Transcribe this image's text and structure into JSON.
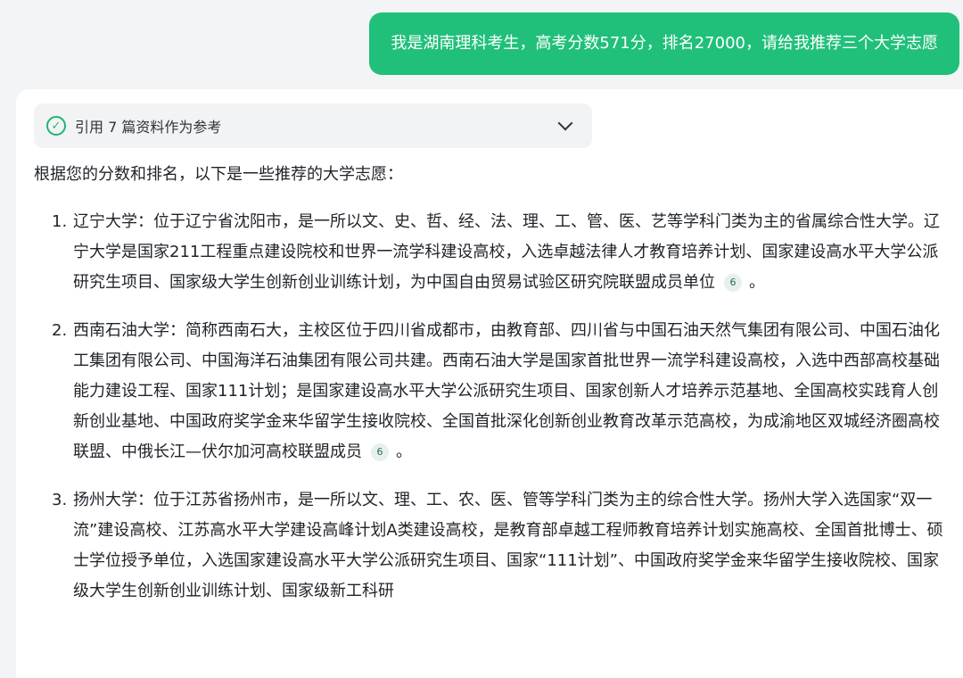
{
  "user_message": "我是湖南理科考生，高考分数571分，排名27000，请给我推荐三个大学志愿",
  "references": {
    "label": "引用 7 篇资料作为参考"
  },
  "answer": {
    "intro": "根据您的分数和排名，以下是一些推荐的大学志愿：",
    "items": [
      {
        "number": "1.",
        "text": "辽宁大学：位于辽宁省沈阳市，是一所以文、史、哲、经、法、理、工、管、医、艺等学科门类为主的省属综合性大学。辽宁大学是国家211工程重点建设院校和世界一流学科建设高校，入选卓越法律人才教育培养计划、国家建设高水平大学公派研究生项目、国家级大学生创新创业训练计划，为中国自由贸易试验区研究院联盟成员单位",
        "citation": "6",
        "tail": "。"
      },
      {
        "number": "2.",
        "text": "西南石油大学：简称西南石大，主校区位于四川省成都市，由教育部、四川省与中国石油天然气集团有限公司、中国石油化工集团有限公司、中国海洋石油集团有限公司共建。西南石油大学是国家首批世界一流学科建设高校，入选中西部高校基础能力建设工程、国家111计划；是国家建设高水平大学公派研究生项目、国家创新人才培养示范基地、全国高校实践育人创新创业基地、中国政府奖学金来华留学生接收院校、全国首批深化创新创业教育改革示范高校，为成渝地区双城经济圈高校联盟、中俄长江—伏尔加河高校联盟成员",
        "citation": "6",
        "tail": "。"
      },
      {
        "number": "3.",
        "text": "扬州大学：位于江苏省扬州市，是一所以文、理、工、农、医、管等学科门类为主的综合性大学。扬州大学入选国家“双一流”建设高校、江苏高水平大学建设高峰计划A类建设高校，是教育部卓越工程师教育培养计划实施高校、全国首批博士、硕士学位授予单位，入选国家建设高水平大学公派研究生项目、国家“111计划”、中国政府奖学金来华留学生接收院校、国家级大学生创新创业训练计划、国家级新工科研",
        "citation": "",
        "tail": ""
      }
    ]
  }
}
